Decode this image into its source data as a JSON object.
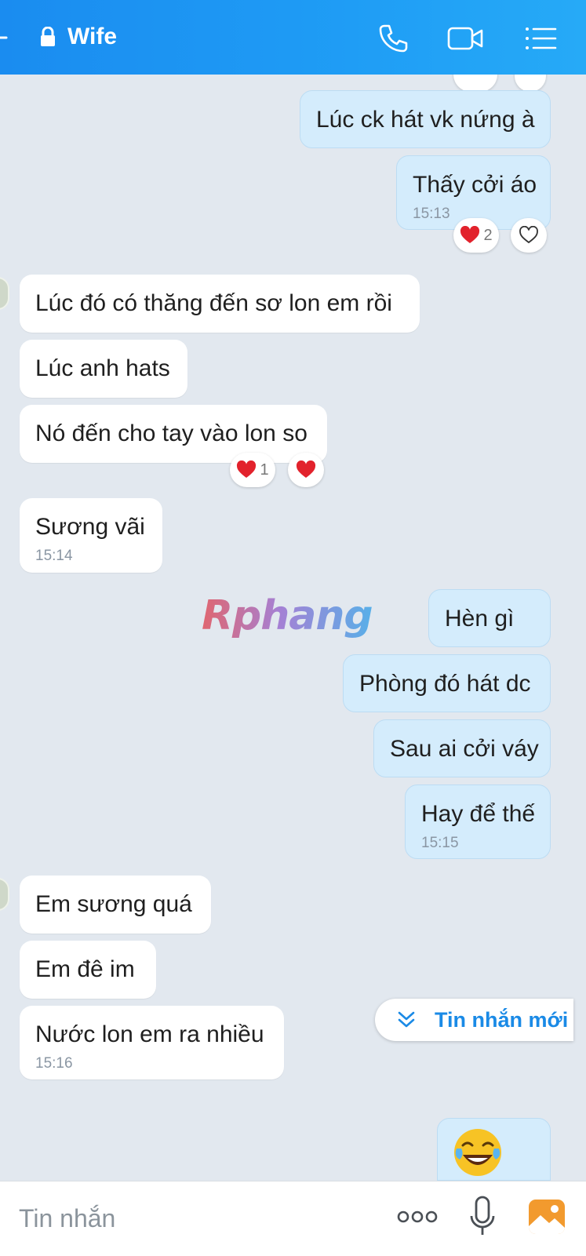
{
  "header": {
    "title": "Wife",
    "icons": [
      "back-icon",
      "lock-icon",
      "phone-icon",
      "video-call-icon",
      "menu-list-icon"
    ]
  },
  "messages": [
    {
      "side": "out",
      "text": "Lúc ck hát vk nứng à"
    },
    {
      "side": "out",
      "text": "Thấy cởi áo",
      "time": "15:13"
    },
    {
      "side": "in",
      "text": "Lúc đó có thăng đến sơ lon em rồi"
    },
    {
      "side": "in",
      "text": "Lúc anh hats"
    },
    {
      "side": "in",
      "text": "Nó đến cho tay vào lon so"
    },
    {
      "side": "in",
      "text": "Sương vãi",
      "time": "15:14"
    },
    {
      "side": "out",
      "text": "Hèn gì"
    },
    {
      "side": "out",
      "text": "Phòng đó hát dc"
    },
    {
      "side": "out",
      "text": "Sau ai cởi váy"
    },
    {
      "side": "out",
      "text": "Hay để thế",
      "time": "15:15"
    },
    {
      "side": "in",
      "text": "Em sương quá"
    },
    {
      "side": "in",
      "text": "Em đê im"
    },
    {
      "side": "in",
      "text": "Nước lon em ra nhiều",
      "time": "15:16"
    }
  ],
  "reactions": {
    "first": {
      "count": "2",
      "icon": "heart-icon"
    },
    "second": {
      "count": "1",
      "icon": "heart-icon"
    }
  },
  "watermark": "Rphang",
  "new_messages_label": "Tin nhắn mới",
  "input": {
    "placeholder": "Tin nhắn"
  },
  "colors": {
    "header": "#1f9df5",
    "incoming_bubble": "#ffffff",
    "outgoing_bubble": "#d4ecfc",
    "chat_background": "#e2e8ef",
    "accent": "#1a8ae6"
  }
}
